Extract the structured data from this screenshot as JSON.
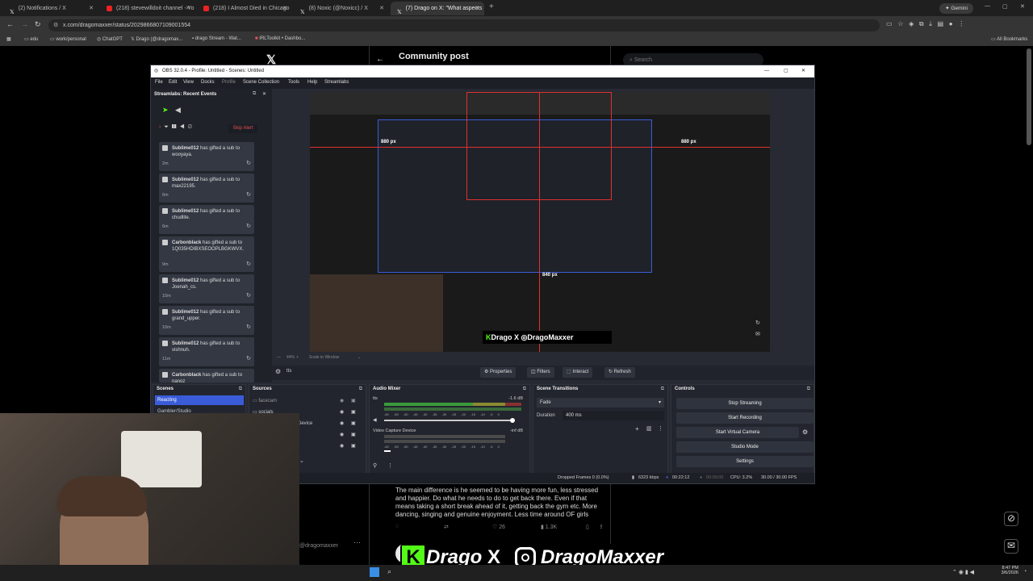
{
  "browser": {
    "tabs": [
      {
        "label": "(2) Notifications / X",
        "icon": "x-icon"
      },
      {
        "label": "(218) stevewilldoit channel - Yo",
        "icon": "youtube-icon"
      },
      {
        "label": "(218) I Almost Died in Chicago",
        "icon": "youtube-icon"
      },
      {
        "label": "(8) Noxic (@Noxicc) / X",
        "icon": "x-icon"
      },
      {
        "label": "(7) Drago on X: \"What aspects",
        "icon": "x-icon",
        "active": true
      }
    ],
    "gemini_label": "Gemini",
    "url": "x.com/dragomaxxer/status/2029866807109001554",
    "bookmarks": [
      "edu",
      "work/personal",
      "ChatGPT",
      "Drago (@dragomax...",
      "drago Stream - Wat...",
      "IRLToolkit • Dashbo..."
    ],
    "all_bookmarks": "All Bookmarks"
  },
  "x": {
    "header_title": "Community post",
    "search_placeholder": "Search",
    "tweet_text": "The main difference is he seemed to be having more fun, less stressed and happier. Do what he needs to do to get back there. Even if that means taking a short break ahead of it, getting back the gym etc. More dancing, singing and genuine enjoyment. Less time around OF girls",
    "reply_count": "",
    "like_count": "26",
    "view_count": "1.3K",
    "author_handle": "@dragomaxxer"
  },
  "obs": {
    "title": "OBS 32.0.4 - Profile: Untitled - Scenes: Untitled",
    "menu": [
      "File",
      "Edit",
      "View",
      "Docks",
      "Profile",
      "Scene Collection",
      "Tools",
      "Help",
      "Streamlabs"
    ],
    "dock_title": "Streamlabs: Recent Events",
    "skip_alert": "Skip Alert",
    "events": [
      {
        "name": "Sublime012",
        "text": "has gifted a sub to wooyaya.",
        "time": "2m"
      },
      {
        "name": "Sublime012",
        "text": "has gifted a sub to max22195.",
        "time": "6m"
      },
      {
        "name": "Sublime012",
        "text": "has gifted a sub to chudlite.",
        "time": "6m"
      },
      {
        "name": "Carbonblack",
        "text": "has gifted a sub to 1Q035HDIBXSEOOPLBGKWVX.",
        "time": "9m"
      },
      {
        "name": "Sublime012",
        "text": "has gifted a sub to Joenah_cs.",
        "time": "10m"
      },
      {
        "name": "Sublime012",
        "text": "has gifted a sub to grand_upper.",
        "time": "10m"
      },
      {
        "name": "Sublime012",
        "text": "has gifted a sub to vishnuh.",
        "time": "11m"
      },
      {
        "name": "Carbonblack",
        "text": "has gifted a sub to nanoz",
        "time": ""
      }
    ],
    "preview_overlay_px": "880 px",
    "preview_overlay_px2": "840 px",
    "zoom": "44%",
    "scale_label": "Scale to Window",
    "source_name": "tts",
    "toolbar": [
      "Properties",
      "Filters",
      "Interact",
      "Refresh"
    ],
    "scenes_title": "Scenes",
    "scenes": [
      "Reacting",
      "Gambler/Studio"
    ],
    "sources_title": "Sources",
    "sources": [
      "facecam",
      "socials",
      "Device",
      "",
      ""
    ],
    "mixer_title": "Audio Mixer",
    "mixer": [
      {
        "name": "tts",
        "db": "-1.6 dB"
      },
      {
        "name": "Video Capture Device",
        "db": "-inf dB"
      }
    ],
    "mixer_ticks": [
      "-60",
      "-55",
      "-50",
      "-45",
      "-40",
      "-35",
      "-30",
      "-25",
      "-20",
      "-15",
      "-10",
      "-5",
      "0"
    ],
    "transitions_title": "Scene Transitions",
    "transition": "Fade",
    "duration_label": "Duration",
    "duration": "400 ms",
    "controls_title": "Controls",
    "controls": [
      "Stop Streaming",
      "Start Recording",
      "Start Virtual Camera",
      "Studio Mode",
      "Settings"
    ],
    "status": {
      "dropped": "Dropped Frames 0 (0.0%)",
      "kbps": "6323 kbps",
      "stream_time": "00:22:12",
      "rec_time": "00:00:00",
      "cpu": "CPU: 3.2%",
      "fps": "30.00 / 30.00 FPS"
    }
  },
  "overlay": {
    "brand": "Drago",
    "handle": "DragoMaxxer",
    "separator": "X"
  },
  "taskbar": {
    "time": "8:47 PM",
    "date": "3/6/2026"
  },
  "colors": {
    "accent_blue": "#3a5cd8",
    "kick_green": "#53fc18",
    "alert_red": "#e05050"
  }
}
